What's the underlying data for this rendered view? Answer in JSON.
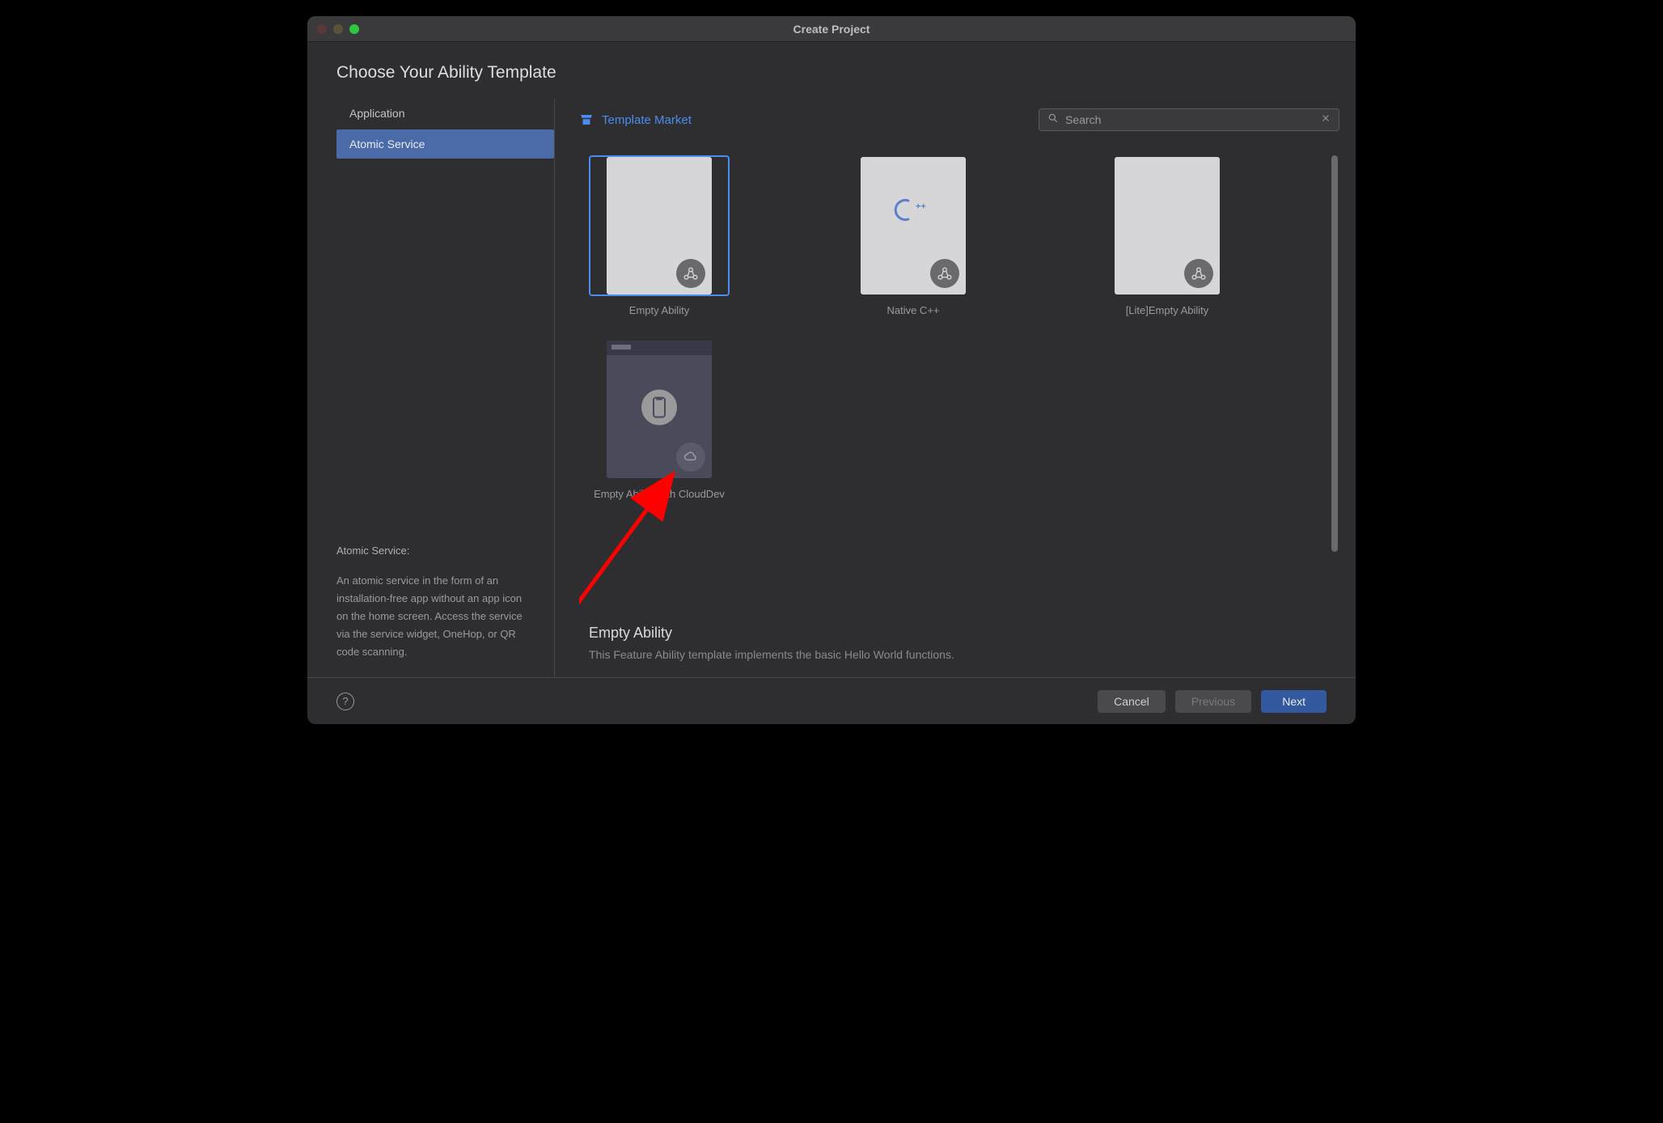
{
  "window": {
    "title": "Create Project"
  },
  "page_heading": "Choose Your Ability Template",
  "sidebar": {
    "items": [
      {
        "label": "Application",
        "selected": false
      },
      {
        "label": "Atomic Service",
        "selected": true
      }
    ],
    "description": {
      "heading": "Atomic Service:",
      "body": "An atomic service in the form of an installation-free app without an app icon on the home screen. Access the service via the service widget, OneHop, or QR code scanning."
    }
  },
  "main": {
    "market_link": "Template Market",
    "search": {
      "placeholder": "Search",
      "value": ""
    },
    "templates": [
      {
        "label": "Empty Ability",
        "selected": true,
        "variant": "light",
        "center": "none",
        "badge": "atom"
      },
      {
        "label": "Native C++",
        "selected": false,
        "variant": "light",
        "center": "cpp",
        "badge": "atom"
      },
      {
        "label": "[Lite]Empty Ability",
        "selected": false,
        "variant": "light",
        "center": "none",
        "badge": "atom"
      },
      {
        "label": "Empty Ability with CloudDev",
        "selected": false,
        "variant": "dark",
        "center": "phone",
        "badge": "cloud"
      }
    ],
    "detail": {
      "title": "Empty Ability",
      "description": "This Feature Ability template implements the basic Hello World functions."
    }
  },
  "footer": {
    "cancel": "Cancel",
    "previous": "Previous",
    "next": "Next"
  }
}
